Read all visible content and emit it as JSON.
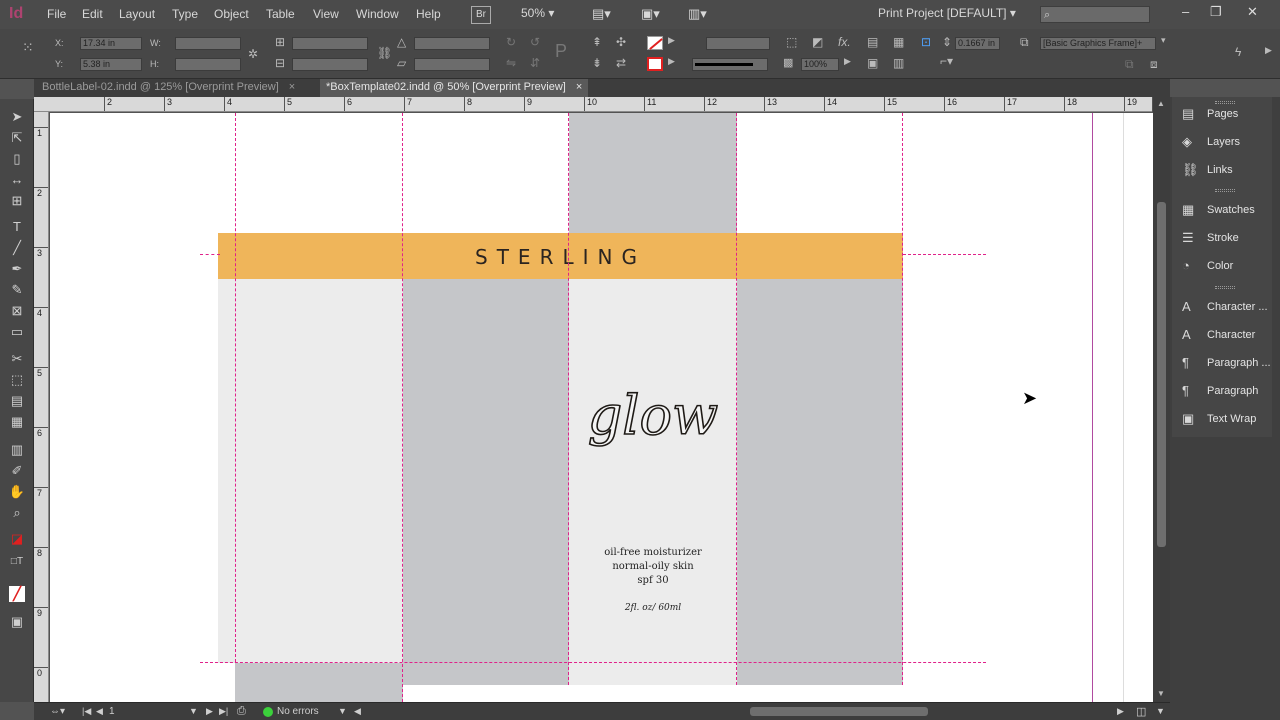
{
  "app": {
    "logo": "Id"
  },
  "menu": [
    "File",
    "Edit",
    "Layout",
    "Type",
    "Object",
    "Table",
    "View",
    "Window",
    "Help"
  ],
  "menubar": {
    "bridge_label": "Br",
    "zoom": "50%",
    "workspace": "Print Project [DEFAULT]"
  },
  "control": {
    "x_label": "X:",
    "x_value": "17.34 in",
    "y_label": "Y:",
    "y_value": "5.38 in",
    "w_label": "W:",
    "h_label": "H:",
    "zoom_percent": "100%",
    "stroke_weight": "0.1667 in",
    "object_style": "[Basic Graphics Frame]+"
  },
  "tabs": [
    {
      "label": "BottleLabel-02.indd @ 125% [Overprint Preview]",
      "close": "×"
    },
    {
      "label": "*BoxTemplate02.indd @ 50% [Overprint Preview]",
      "close": "×"
    }
  ],
  "ruler": {
    "h": [
      "2",
      "3",
      "4",
      "5",
      "6",
      "7",
      "8",
      "9",
      "10",
      "11",
      "12",
      "13",
      "14",
      "15",
      "16",
      "17",
      "18",
      "19"
    ],
    "v": [
      "1",
      "2",
      "3",
      "4",
      "5",
      "6",
      "7",
      "8",
      "9",
      "0"
    ]
  },
  "artwork": {
    "brand": "STERLING",
    "logo_text": "glow",
    "desc_line1": "oil-free moisturizer",
    "desc_line2": "normal-oily skin",
    "desc_line3": "spf 30",
    "volume": "2fl. oz/ 60ml",
    "band_color": "#efb55a",
    "gray_dark": "#c5c6c9",
    "gray_light": "#ececec",
    "guide_color": "#e0218a"
  },
  "status": {
    "page": "1",
    "preflight": "No errors"
  },
  "panels": [
    {
      "label": "Pages",
      "icon": "pages-icon"
    },
    {
      "label": "Layers",
      "icon": "layers-icon"
    },
    {
      "label": "Links",
      "icon": "links-icon"
    },
    {
      "label": "Swatches",
      "icon": "swatches-icon"
    },
    {
      "label": "Stroke",
      "icon": "stroke-icon"
    },
    {
      "label": "Color",
      "icon": "color-icon"
    },
    {
      "label": "Character ...",
      "icon": "character-styles-icon"
    },
    {
      "label": "Character",
      "icon": "character-icon"
    },
    {
      "label": "Paragraph ...",
      "icon": "paragraph-styles-icon"
    },
    {
      "label": "Paragraph",
      "icon": "paragraph-icon"
    },
    {
      "label": "Text Wrap",
      "icon": "text-wrap-icon"
    }
  ]
}
